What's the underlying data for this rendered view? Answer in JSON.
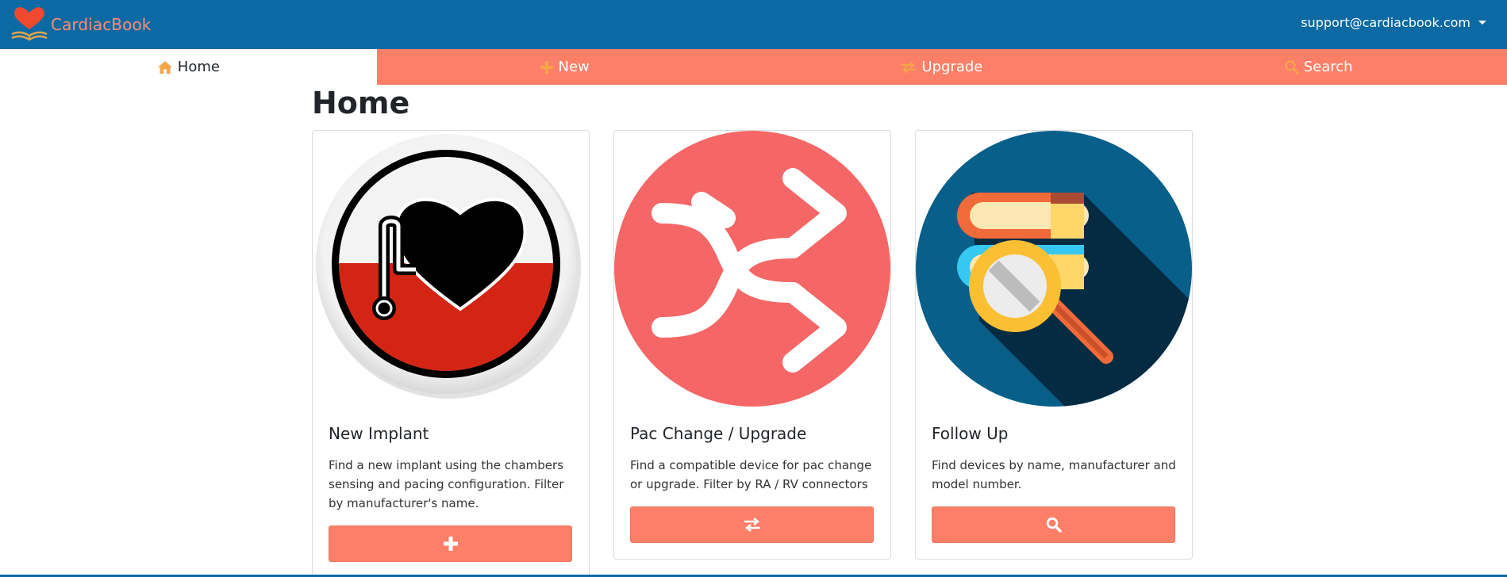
{
  "header": {
    "brand": "CardiacBook",
    "user_email": "support@cardiacbook.com"
  },
  "nav": {
    "tabs": [
      {
        "label": "Home",
        "icon": "home-icon",
        "active": true
      },
      {
        "label": "New",
        "icon": "plus-icon",
        "active": false
      },
      {
        "label": "Upgrade",
        "icon": "exchange-icon",
        "active": false
      },
      {
        "label": "Search",
        "icon": "search-icon",
        "active": false
      }
    ]
  },
  "main": {
    "title": "Home",
    "cards": [
      {
        "title": "New Implant",
        "text": "Find a new implant using the chambers sensing and pacing configuration. Filter by manufacturer's name.",
        "image": "pacemaker-heart-icon",
        "button_icon": "plus-icon"
      },
      {
        "title": "Pac Change / Upgrade",
        "text": "Find a compatible device for pac change or upgrade. Filter by RA / RV connectors",
        "image": "shuffle-arrows-icon",
        "button_icon": "exchange-icon"
      },
      {
        "title": "Follow Up",
        "text": "Find devices by name, manufacturer and model number.",
        "image": "books-magnifier-icon",
        "button_icon": "search-icon"
      }
    ]
  },
  "colors": {
    "topbar": "#0b69a3",
    "accent": "#fd7f67",
    "brand_text": "#ff8c75",
    "nav_icon": "#f5a54a"
  }
}
